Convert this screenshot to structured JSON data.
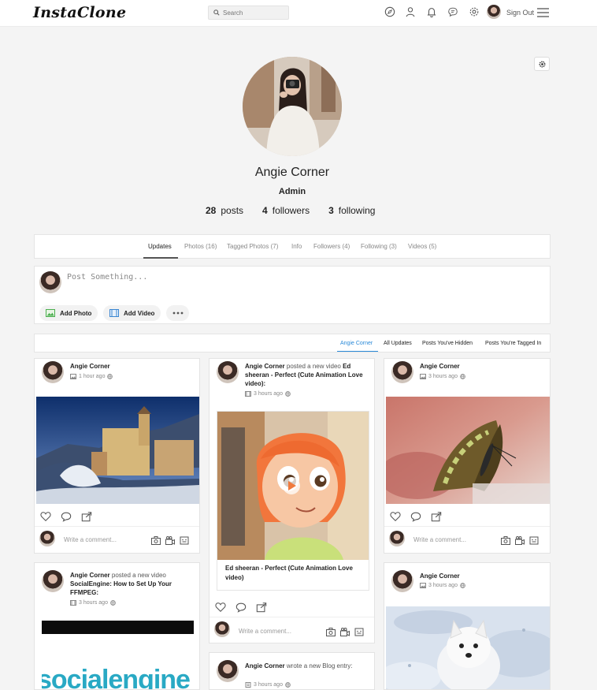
{
  "app": {
    "logo": "InstaClone",
    "search_placeholder": "Search",
    "sign_out": "Sign Out"
  },
  "profile": {
    "name": "Angie Corner",
    "role": "Admin",
    "stats": {
      "posts_count": "28",
      "posts_label": "posts",
      "followers_count": "4",
      "followers_label": "followers",
      "following_count": "3",
      "following_label": "following"
    }
  },
  "tabs": [
    {
      "label": "Updates",
      "active": true
    },
    {
      "label": "Photos (16)"
    },
    {
      "label": "Tagged Photos (7)"
    },
    {
      "label": "Info"
    },
    {
      "label": "Followers (4)"
    },
    {
      "label": "Following (3)"
    },
    {
      "label": "Videos (5)"
    }
  ],
  "composer": {
    "placeholder": "Post Something...",
    "add_photo": "Add Photo",
    "add_video": "Add Video"
  },
  "filters": [
    {
      "label": "Angie Corner",
      "active": true
    },
    {
      "label": "All Updates"
    },
    {
      "label": "Posts You've Hidden"
    },
    {
      "label": "Posts You're Tagged In"
    }
  ],
  "feed": {
    "comment_placeholder": "Write a comment...",
    "posts": [
      {
        "author": "Angie Corner",
        "verb": "",
        "title": "",
        "time": "1 hour ago"
      },
      {
        "author": "Angie Corner",
        "verb": "posted a new video",
        "title": "Ed sheeran - Perfect (Cute Animation Love video):",
        "time": "3 hours ago",
        "caption": "Ed sheeran - Perfect (Cute Animation Love video)"
      },
      {
        "author": "Angie Corner",
        "verb": "",
        "title": "",
        "time": "3 hours ago"
      },
      {
        "author": "Angie Corner",
        "verb": "posted a new video",
        "title": "SocialEngine: How to Set Up Your FFMPEG:",
        "time": "3 hours ago",
        "image_text": "socialengine"
      },
      {
        "author": "Angie Corner",
        "verb": "wrote a new Blog entry:",
        "title": "",
        "time": "3 hours ago"
      },
      {
        "author": "Angie Corner",
        "verb": "",
        "title": "",
        "time": "3 hours ago"
      }
    ]
  },
  "colors": {
    "accent": "#2b8ad8",
    "page_bg": "#f4f4f4"
  }
}
